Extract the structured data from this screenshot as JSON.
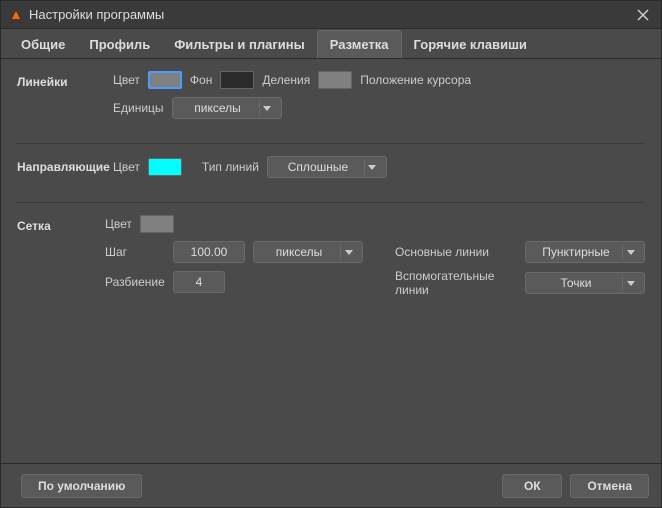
{
  "window": {
    "title": "Настройки программы"
  },
  "tabs": {
    "general": "Общие",
    "profile": "Профиль",
    "filters": "Фильтры и плагины",
    "markup": "Разметка",
    "hotkeys": "Горячие клавиши"
  },
  "rulers": {
    "section": "Линейки",
    "color_label": "Цвет",
    "color": "#808080",
    "bg_label": "Фон",
    "bg_color": "#2a2a2a",
    "divisions_label": "Деления",
    "divisions_color": "#808080",
    "cursor_pos_label": "Положение курсора",
    "units_label": "Единицы",
    "units_value": "пикселы"
  },
  "guides": {
    "section": "Направляющие",
    "color_label": "Цвет",
    "color": "#00ffff",
    "line_type_label": "Тип линий",
    "line_type_value": "Сплошные"
  },
  "grid": {
    "section": "Сетка",
    "color_label": "Цвет",
    "color": "#808080",
    "step_label": "Шаг",
    "step_value": "100.00",
    "units_value": "пикселы",
    "subdivision_label": "Разбиение",
    "subdivision_value": "4",
    "main_lines_label": "Основные линии",
    "main_lines_value": "Пунктирные",
    "aux_lines_label": "Вспомогательные линии",
    "aux_lines_value": "Точки"
  },
  "footer": {
    "defaults": "По умолчанию",
    "ok": "ОК",
    "cancel": "Отмена"
  }
}
